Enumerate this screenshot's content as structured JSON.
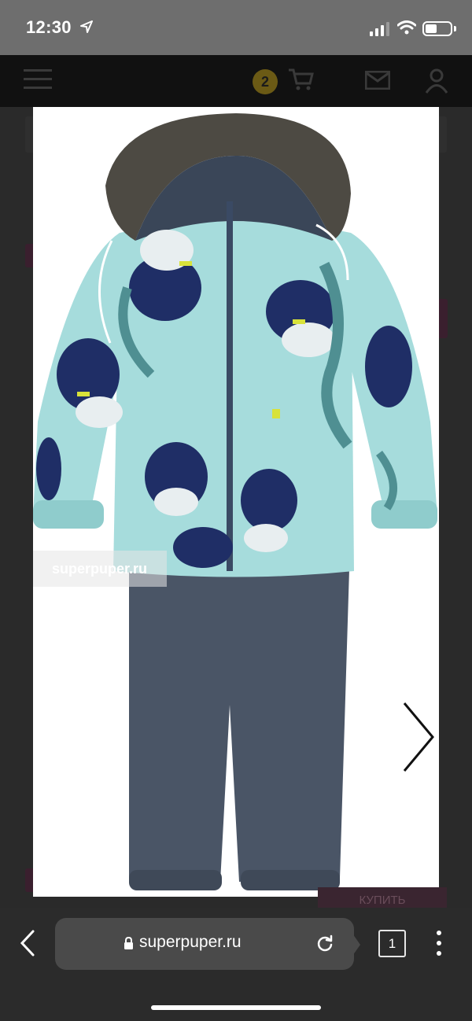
{
  "status": {
    "time": "12:30",
    "icons": [
      "location-arrow-icon",
      "cellular-signal-icon",
      "wifi-icon",
      "battery-icon"
    ]
  },
  "site": {
    "cart_count": "2",
    "icons": [
      "menu-icon",
      "cart-icon",
      "mail-icon",
      "user-icon"
    ],
    "buy_label": "КУПИТЬ"
  },
  "photo": {
    "watermark": "superpuper.ru",
    "icons": [
      "chevron-right-icon"
    ]
  },
  "browser": {
    "url": "superpuper.ru",
    "tab_count": "1",
    "icons": [
      "back-icon",
      "lock-icon",
      "reload-icon",
      "tabs-icon",
      "more-icon"
    ]
  },
  "colors": {
    "jacket": "#a6dcdc",
    "jacket_print": "#1f2e66",
    "pants": "#4a5566",
    "fur": "#4d4a43",
    "overlay": "#1b1b1b"
  }
}
